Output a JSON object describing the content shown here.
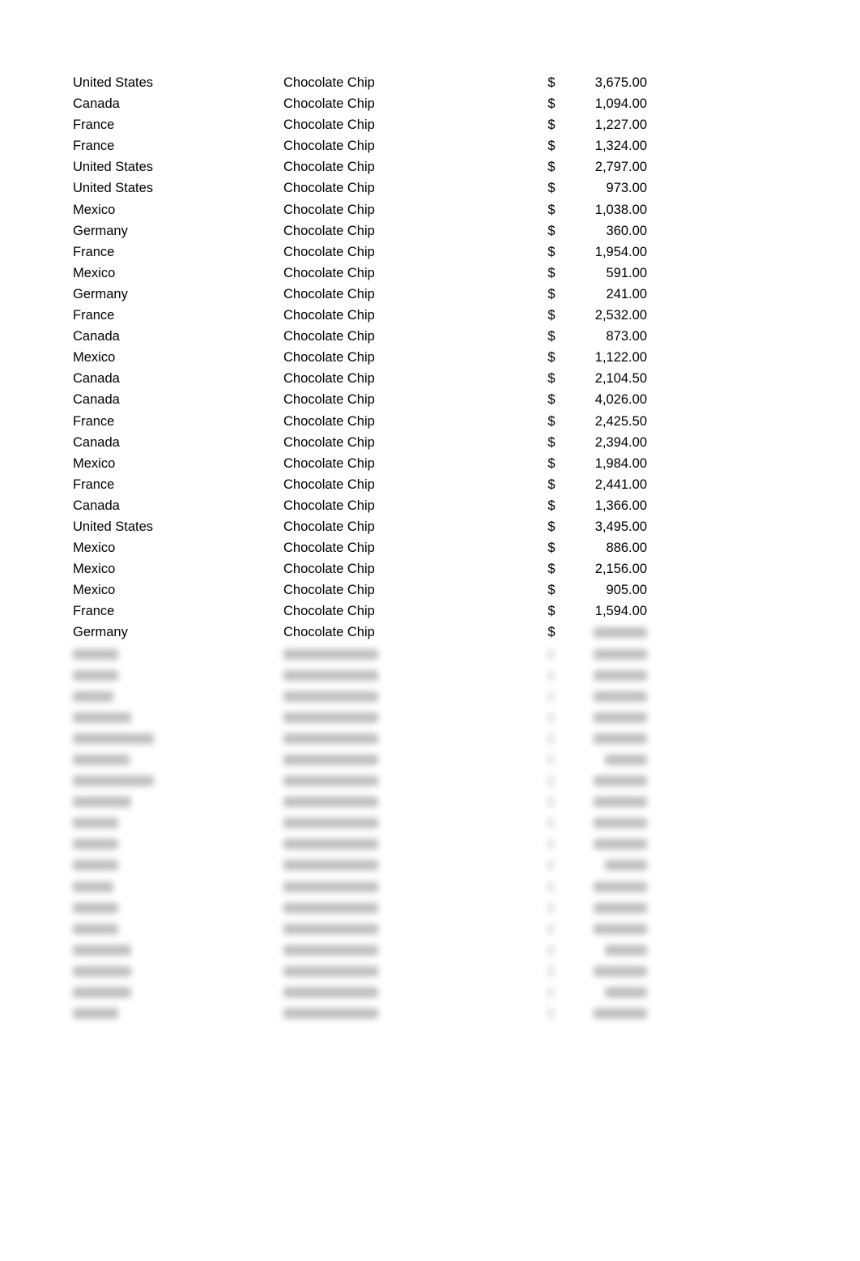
{
  "table": {
    "currency_symbol": "$",
    "rows": [
      {
        "country": "United States",
        "product": "Chocolate Chip",
        "amount": "3,675.00"
      },
      {
        "country": "Canada",
        "product": "Chocolate Chip",
        "amount": "1,094.00"
      },
      {
        "country": "France",
        "product": "Chocolate Chip",
        "amount": "1,227.00"
      },
      {
        "country": "France",
        "product": "Chocolate Chip",
        "amount": "1,324.00"
      },
      {
        "country": "United States",
        "product": "Chocolate Chip",
        "amount": "2,797.00"
      },
      {
        "country": "United States",
        "product": "Chocolate Chip",
        "amount": "973.00"
      },
      {
        "country": "Mexico",
        "product": "Chocolate Chip",
        "amount": "1,038.00"
      },
      {
        "country": "Germany",
        "product": "Chocolate Chip",
        "amount": "360.00"
      },
      {
        "country": "France",
        "product": "Chocolate Chip",
        "amount": "1,954.00"
      },
      {
        "country": "Mexico",
        "product": "Chocolate Chip",
        "amount": "591.00"
      },
      {
        "country": "Germany",
        "product": "Chocolate Chip",
        "amount": "241.00"
      },
      {
        "country": "France",
        "product": "Chocolate Chip",
        "amount": "2,532.00"
      },
      {
        "country": "Canada",
        "product": "Chocolate Chip",
        "amount": "873.00"
      },
      {
        "country": "Mexico",
        "product": "Chocolate Chip",
        "amount": "1,122.00"
      },
      {
        "country": "Canada",
        "product": "Chocolate Chip",
        "amount": "2,104.50"
      },
      {
        "country": "Canada",
        "product": "Chocolate Chip",
        "amount": "4,026.00"
      },
      {
        "country": "France",
        "product": "Chocolate Chip",
        "amount": "2,425.50"
      },
      {
        "country": "Canada",
        "product": "Chocolate Chip",
        "amount": "2,394.00"
      },
      {
        "country": "Mexico",
        "product": "Chocolate Chip",
        "amount": "1,984.00"
      },
      {
        "country": "France",
        "product": "Chocolate Chip",
        "amount": "2,441.00"
      },
      {
        "country": "Canada",
        "product": "Chocolate Chip",
        "amount": "1,366.00"
      },
      {
        "country": "United States",
        "product": "Chocolate Chip",
        "amount": "3,495.00"
      },
      {
        "country": "Mexico",
        "product": "Chocolate Chip",
        "amount": "886.00"
      },
      {
        "country": "Mexico",
        "product": "Chocolate Chip",
        "amount": "2,156.00"
      },
      {
        "country": "Mexico",
        "product": "Chocolate Chip",
        "amount": "905.00"
      },
      {
        "country": "France",
        "product": "Chocolate Chip",
        "amount": "1,594.00"
      },
      {
        "country": "Germany",
        "product": "Chocolate Chip",
        "amount": null
      }
    ],
    "blurred_row_count": 18
  }
}
